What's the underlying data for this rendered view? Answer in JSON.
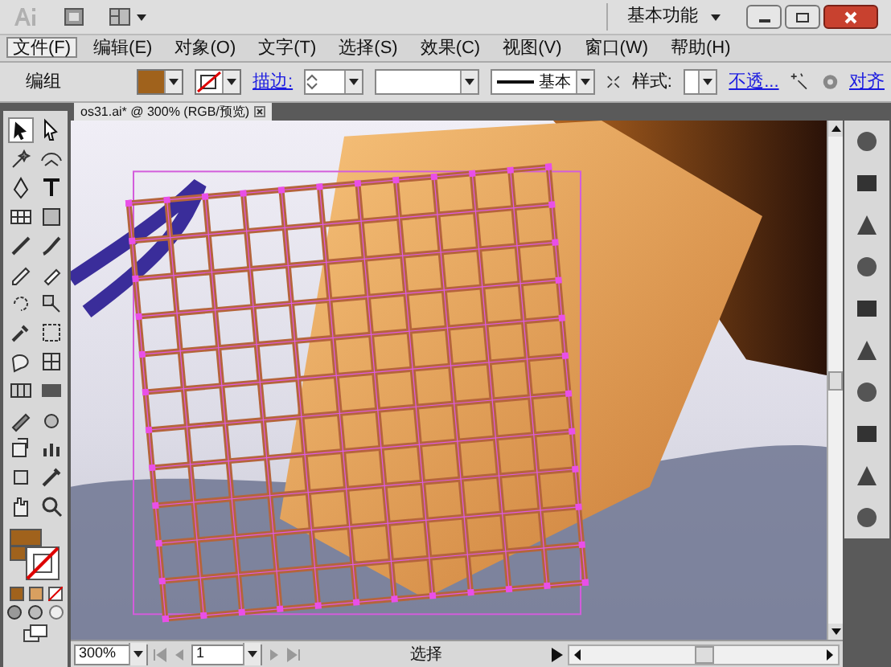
{
  "title_bar": {
    "workspace": "基本功能"
  },
  "menu": [
    {
      "label": "文件(F)",
      "selected": true
    },
    {
      "label": "编辑(E)",
      "selected": false
    },
    {
      "label": "对象(O)",
      "selected": false
    },
    {
      "label": "文字(T)",
      "selected": false
    },
    {
      "label": "选择(S)",
      "selected": false
    },
    {
      "label": "效果(C)",
      "selected": false
    },
    {
      "label": "视图(V)",
      "selected": false
    },
    {
      "label": "窗口(W)",
      "selected": false
    },
    {
      "label": "帮助(H)",
      "selected": false
    }
  ],
  "control_bar": {
    "selection": "编组",
    "stroke_link": "描边:",
    "line_style": "基本",
    "style_label": "样式:",
    "opacity_link": "不透...",
    "align_link": "对齐"
  },
  "document_tab": {
    "title": "os31.ai* @ 300% (RGB/预览)"
  },
  "status_bar": {
    "zoom": "300%",
    "artboard": "1",
    "tool": "选择"
  }
}
